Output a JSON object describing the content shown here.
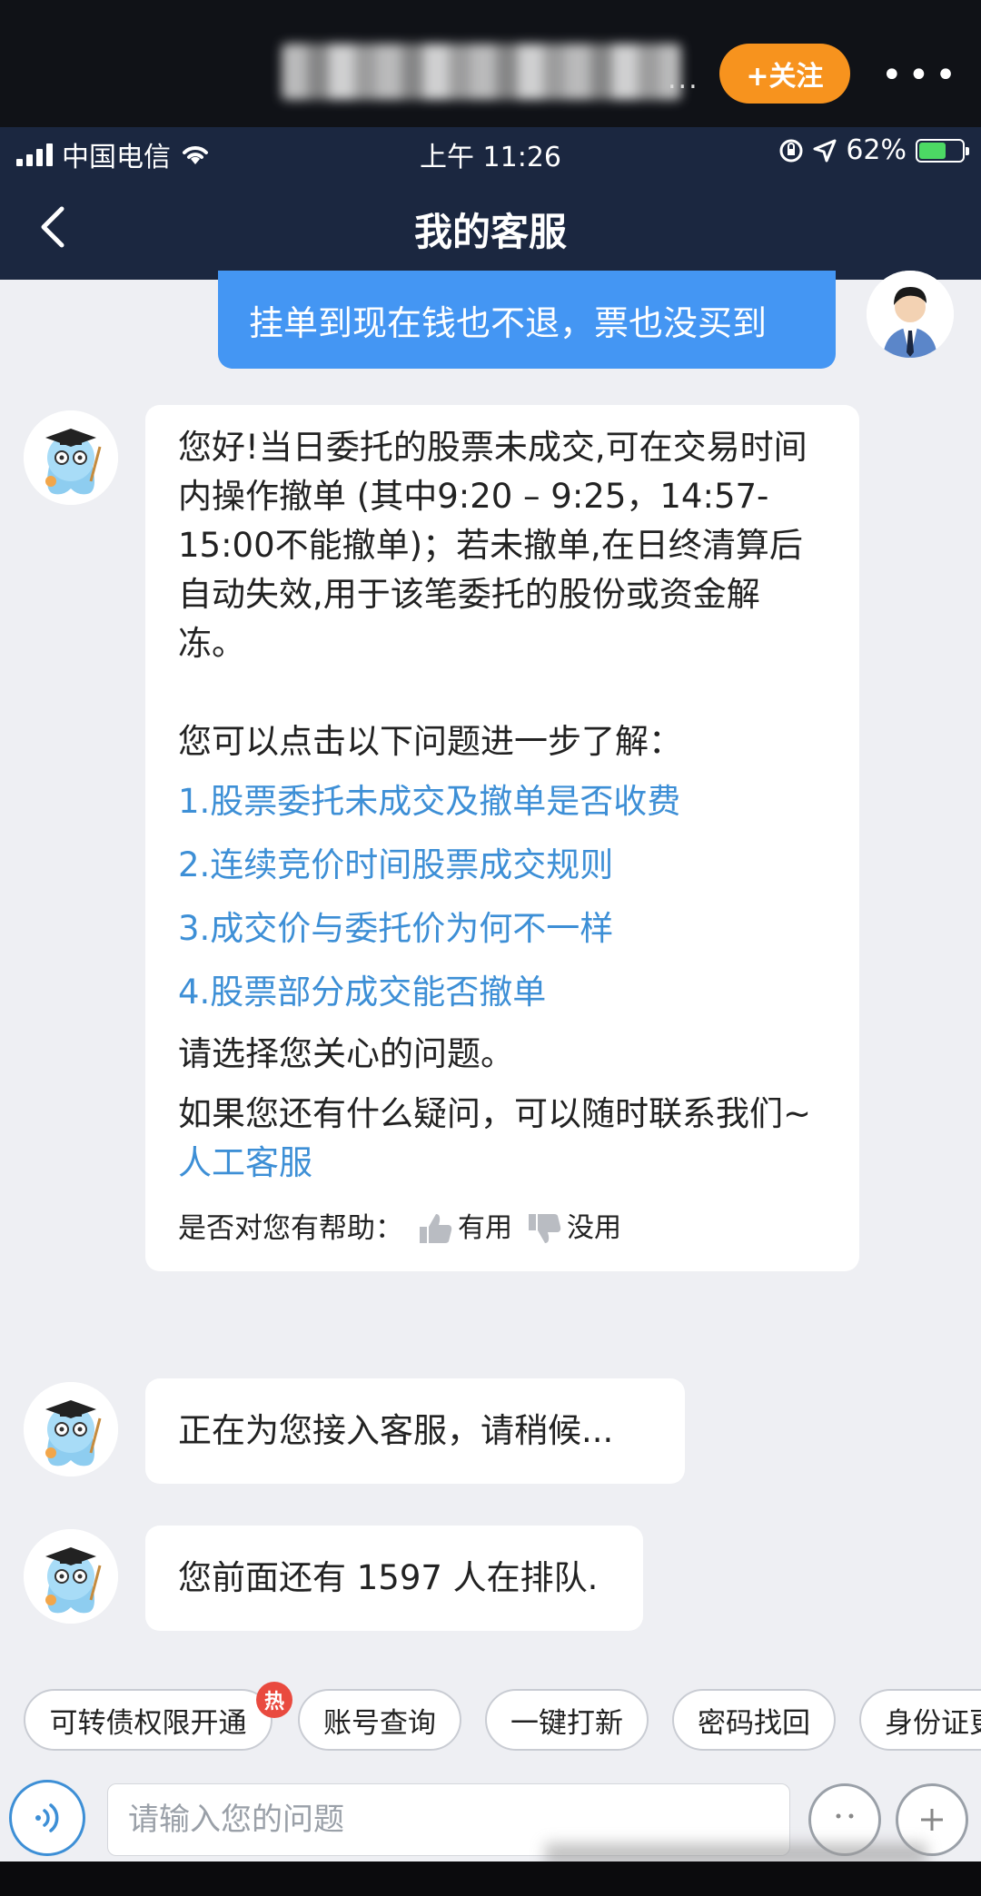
{
  "overlay": {
    "follow_label": "+关注",
    "more_label": "•••",
    "name_tail": "..."
  },
  "status": {
    "carrier": "中国电信",
    "time": "上午 11:26",
    "battery": "62%"
  },
  "nav": {
    "title": "我的客服"
  },
  "messages": {
    "user1": "挂单到现在钱也不退，票也没买到",
    "bot1": {
      "intro": "您好!当日委托的股票未成交,可在交易时间内操作撤单 (其中9:20 – 9:25，14:57-15:00不能撤单)；若未撤单,在日终清算后自动失效,用于该笔委托的股份或资金解冻。",
      "more_prompt": "您可以点击以下问题进一步了解：",
      "questions": [
        "1.股票委托未成交及撤单是否收费",
        "2.连续竞价时间股票成交规则",
        "3.成交价与委托价为何不一样",
        "4.股票部分成交能否撤单"
      ],
      "choose": "请选择您关心的问题。",
      "contact_text": "如果您还有什么疑问，可以随时联系我们~",
      "contact_link": "人工客服",
      "helpful_q": "是否对您有帮助：",
      "useful": "有用",
      "useless": "没用"
    },
    "bot2": "正在为您接入客服，请稍候...",
    "bot3": "您前面还有 1597 人在排队."
  },
  "quick_replies": [
    "可转债权限开通",
    "账号查询",
    "一键打新",
    "密码找回",
    "身份证更"
  ],
  "hot_badge": "热",
  "input": {
    "placeholder": "请输入您的问题"
  },
  "colors": {
    "nav_bg": "#1b2740",
    "user_bubble": "#4496f3",
    "link": "#3d8fd6",
    "follow": "#f7931e"
  }
}
